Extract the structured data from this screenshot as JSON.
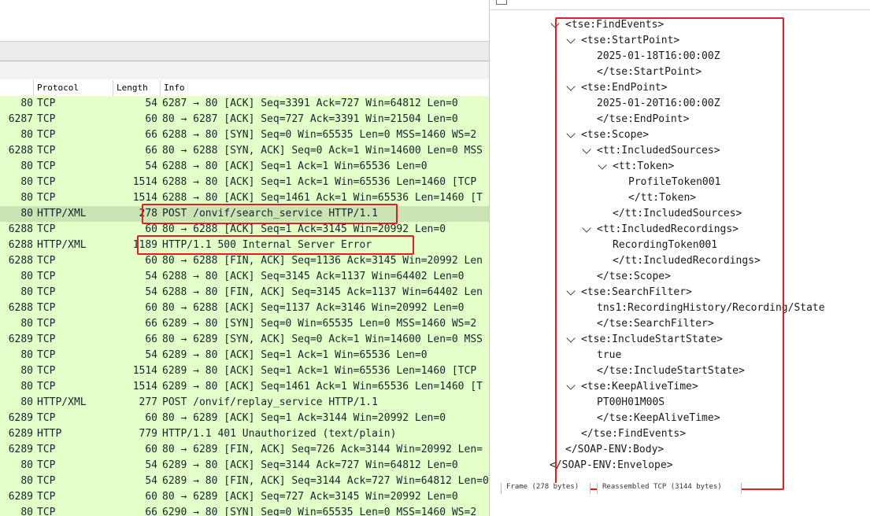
{
  "columns": {
    "protocol": "Protocol",
    "length": "Length",
    "info": "Info"
  },
  "packets": [
    {
      "port": "80",
      "proto": "TCP",
      "len": "54",
      "info": "6287 → 80 [ACK] Seq=3391 Ack=727 Win=64812 Len=0",
      "style": "green"
    },
    {
      "port": "6287",
      "proto": "TCP",
      "len": "60",
      "info": "80 → 6287 [ACK] Seq=727 Ack=3391 Win=21504 Len=0",
      "style": "green"
    },
    {
      "port": "80",
      "proto": "TCP",
      "len": "66",
      "info": "6288 → 80 [SYN] Seq=0 Win=65535 Len=0 MSS=1460 WS=2",
      "style": "green"
    },
    {
      "port": "6288",
      "proto": "TCP",
      "len": "66",
      "info": "80 → 6288 [SYN, ACK] Seq=0 Ack=1 Win=14600 Len=0 MSS",
      "style": "green"
    },
    {
      "port": "80",
      "proto": "TCP",
      "len": "54",
      "info": "6288 → 80 [ACK] Seq=1 Ack=1 Win=65536 Len=0",
      "style": "green"
    },
    {
      "port": "80",
      "proto": "TCP",
      "len": "1514",
      "info": "6288 → 80 [ACK] Seq=1 Ack=1 Win=65536 Len=1460 [TCP",
      "style": "green"
    },
    {
      "port": "80",
      "proto": "TCP",
      "len": "1514",
      "info": "6288 → 80 [ACK] Seq=1461 Ack=1 Win=65536 Len=1460 [T",
      "style": "green"
    },
    {
      "port": "80",
      "proto": "HTTP/XML",
      "len": "278",
      "info": "POST /onvif/search_service HTTP/1.1",
      "style": "selected"
    },
    {
      "port": "6288",
      "proto": "TCP",
      "len": "60",
      "info": "80 → 6288 [ACK] Seq=1 Ack=3145 Win=20992 Len=0",
      "style": "green"
    },
    {
      "port": "6288",
      "proto": "HTTP/XML",
      "len": "1189",
      "info": "HTTP/1.1 500 Internal Server Error",
      "style": "green"
    },
    {
      "port": "6288",
      "proto": "TCP",
      "len": "60",
      "info": "80 → 6288 [FIN, ACK] Seq=1136 Ack=3145 Win=20992 Len",
      "style": "green"
    },
    {
      "port": "80",
      "proto": "TCP",
      "len": "54",
      "info": "6288 → 80 [ACK] Seq=3145 Ack=1137 Win=64402 Len=0",
      "style": "green"
    },
    {
      "port": "80",
      "proto": "TCP",
      "len": "54",
      "info": "6288 → 80 [FIN, ACK] Seq=3145 Ack=1137 Win=64402 Len",
      "style": "green"
    },
    {
      "port": "6288",
      "proto": "TCP",
      "len": "60",
      "info": "80 → 6288 [ACK] Seq=1137 Ack=3146 Win=20992 Len=0",
      "style": "green"
    },
    {
      "port": "80",
      "proto": "TCP",
      "len": "66",
      "info": "6289 → 80 [SYN] Seq=0 Win=65535 Len=0 MSS=1460 WS=2",
      "style": "green"
    },
    {
      "port": "6289",
      "proto": "TCP",
      "len": "66",
      "info": "80 → 6289 [SYN, ACK] Seq=0 Ack=1 Win=14600 Len=0 MSS",
      "style": "green"
    },
    {
      "port": "80",
      "proto": "TCP",
      "len": "54",
      "info": "6289 → 80 [ACK] Seq=1 Ack=1 Win=65536 Len=0",
      "style": "green"
    },
    {
      "port": "80",
      "proto": "TCP",
      "len": "1514",
      "info": "6289 → 80 [ACK] Seq=1 Ack=1 Win=65536 Len=1460 [TCP",
      "style": "green"
    },
    {
      "port": "80",
      "proto": "TCP",
      "len": "1514",
      "info": "6289 → 80 [ACK] Seq=1461 Ack=1 Win=65536 Len=1460 [T",
      "style": "green"
    },
    {
      "port": "80",
      "proto": "HTTP/XML",
      "len": "277",
      "info": "POST /onvif/replay_service HTTP/1.1",
      "style": "green"
    },
    {
      "port": "6289",
      "proto": "TCP",
      "len": "60",
      "info": "80 → 6289 [ACK] Seq=1 Ack=3144 Win=20992 Len=0",
      "style": "green"
    },
    {
      "port": "6289",
      "proto": "HTTP",
      "len": "779",
      "info": "HTTP/1.1 401 Unauthorized  (text/plain)",
      "style": "green"
    },
    {
      "port": "6289",
      "proto": "TCP",
      "len": "60",
      "info": "80 → 6289 [FIN, ACK] Seq=726 Ack=3144 Win=20992 Len=",
      "style": "green"
    },
    {
      "port": "80",
      "proto": "TCP",
      "len": "54",
      "info": "6289 → 80 [ACK] Seq=3144 Ack=727 Win=64812 Len=0",
      "style": "green"
    },
    {
      "port": "80",
      "proto": "TCP",
      "len": "54",
      "info": "6289 → 80 [FIN, ACK] Seq=3144 Ack=727 Win=64812 Len=0",
      "style": "green"
    },
    {
      "port": "6289",
      "proto": "TCP",
      "len": "60",
      "info": "80 → 6289 [ACK] Seq=727 Ack=3145 Win=20992 Len=0",
      "style": "green"
    },
    {
      "port": "80",
      "proto": "TCP",
      "len": "66",
      "info": "6290 → 80 [SYN] Seq=0 Win=65535 Len=0 MSS=1460 WS=2",
      "style": "green"
    }
  ],
  "xml_tree": [
    {
      "text": "<tse:FindEvents>",
      "depth": 0,
      "chevron": true
    },
    {
      "text": "<tse:StartPoint>",
      "depth": 1,
      "chevron": true
    },
    {
      "text": "2025-01-18T16:00:00Z",
      "depth": 2,
      "chevron": false
    },
    {
      "text": "</tse:StartPoint>",
      "depth": 2,
      "chevron": false
    },
    {
      "text": "<tse:EndPoint>",
      "depth": 1,
      "chevron": true
    },
    {
      "text": "2025-01-20T16:00:00Z",
      "depth": 2,
      "chevron": false
    },
    {
      "text": "</tse:EndPoint>",
      "depth": 2,
      "chevron": false
    },
    {
      "text": "<tse:Scope>",
      "depth": 1,
      "chevron": true
    },
    {
      "text": "<tt:IncludedSources>",
      "depth": 2,
      "chevron": true
    },
    {
      "text": "<tt:Token>",
      "depth": 3,
      "chevron": true
    },
    {
      "text": "ProfileToken001",
      "depth": 4,
      "chevron": false
    },
    {
      "text": "</tt:Token>",
      "depth": 4,
      "chevron": false
    },
    {
      "text": "</tt:IncludedSources>",
      "depth": 3,
      "chevron": false
    },
    {
      "text": "<tt:IncludedRecordings>",
      "depth": 2,
      "chevron": true
    },
    {
      "text": "RecordingToken001",
      "depth": 3,
      "chevron": false
    },
    {
      "text": "</tt:IncludedRecordings>",
      "depth": 3,
      "chevron": false
    },
    {
      "text": "</tse:Scope>",
      "depth": 2,
      "chevron": false
    },
    {
      "text": "<tse:SearchFilter>",
      "depth": 1,
      "chevron": true
    },
    {
      "text": "tns1:RecordingHistory/Recording/State",
      "depth": 2,
      "chevron": false
    },
    {
      "text": "</tse:SearchFilter>",
      "depth": 2,
      "chevron": false
    },
    {
      "text": "<tse:IncludeStartState>",
      "depth": 1,
      "chevron": true
    },
    {
      "text": "true",
      "depth": 2,
      "chevron": false
    },
    {
      "text": "</tse:IncludeStartState>",
      "depth": 2,
      "chevron": false
    },
    {
      "text": "<tse:KeepAliveTime>",
      "depth": 1,
      "chevron": true
    },
    {
      "text": "PT00H01M00S",
      "depth": 2,
      "chevron": false
    },
    {
      "text": "</tse:KeepAliveTime>",
      "depth": 2,
      "chevron": false
    },
    {
      "text": "</tse:FindEvents>",
      "depth": 1,
      "chevron": false
    },
    {
      "text": "</SOAP-ENV:Body>",
      "depth": 0,
      "chevron": false
    },
    {
      "text": "</SOAP-ENV:Envelope>",
      "depth": -1,
      "chevron": false
    }
  ],
  "tabs": {
    "frame": "Frame (278 bytes)",
    "reassembled": "Reassembled TCP (3144 bytes)"
  },
  "colors": {
    "tcp_row": "#e7e6ff",
    "green_row": "#e4ffc7",
    "selected_row": "#cbe4b3",
    "annotation_red": "#e02020"
  }
}
